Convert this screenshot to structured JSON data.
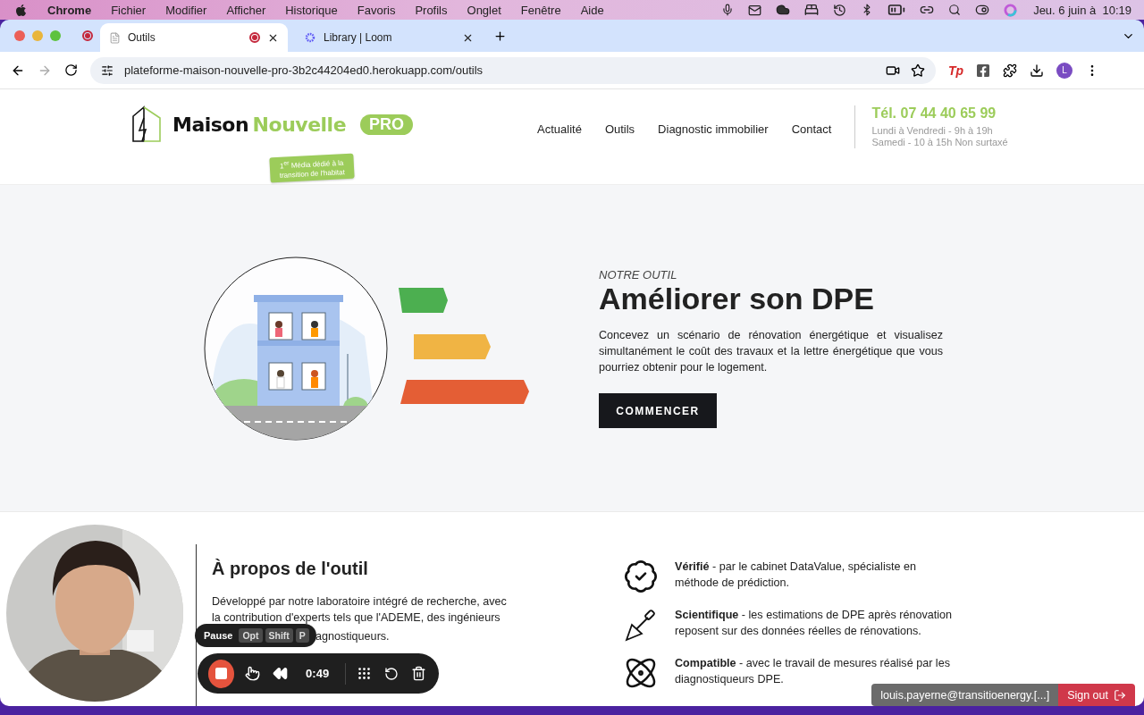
{
  "menubar": {
    "app": "Chrome",
    "menus": [
      "Fichier",
      "Modifier",
      "Afficher",
      "Historique",
      "Favoris",
      "Profils",
      "Onglet",
      "Fenêtre",
      "Aide"
    ],
    "clock": "Jeu. 6 juin à  10:19"
  },
  "tabs": [
    {
      "title": "Outils",
      "selected": true,
      "recording": true
    },
    {
      "title": "Library | Loom",
      "selected": false,
      "recording": false
    }
  ],
  "address": {
    "url": "plateforme-maison-nouvelle-pro-3b2c44204ed0.herokuapp.com/outils"
  },
  "extension_label": "Tp",
  "profile_initial": "L",
  "site": {
    "logo": {
      "word1": "Maison",
      "word2": "Nouvelle",
      "badge": "PRO",
      "tagline": "1$^{er}$ Média dédié à la transition de l'habitat"
    },
    "nav": [
      "Actualité",
      "Outils",
      "Diagnostic immobilier",
      "Contact"
    ],
    "phone": "Tél. 07 44 40 65 99",
    "hours": [
      "Lundi à Vendredi - 9h à 19h",
      "Samedi - 10 à 15h Non surtaxé"
    ]
  },
  "hero": {
    "eyebrow": "NOTRE OUTIL",
    "title": "Améliorer son DPE",
    "text": "Concevez un scénario de rénovation énergétique et visualisez simultanément le coût des travaux et la lettre énergétique que vous pourriez obtenir pour le logement.",
    "button": "COMMENCER"
  },
  "about": {
    "title": "À propos de l'outil",
    "text": "Développé par notre laboratoire intégré de recherche, avec la contribution d'experts tels que l'ADEME, des ingénieurs",
    "text_tail": "agnostiqueurs.",
    "features": [
      {
        "kind": "verified",
        "text": "**Vérifié** - par le cabinet DataValue, spécialiste en méthode de prédiction."
      },
      {
        "kind": "trowel",
        "text": "**Scientifique** - les estimations de DPE après rénovation reposent sur des données réelles de rénovations."
      },
      {
        "kind": "atom",
        "text": "**Compatible** - avec le travail de mesures réalisé par les diagnostiqueurs DPE."
      }
    ]
  },
  "recorder": {
    "tooltip": "Pause",
    "keys": [
      "Opt",
      "Shift",
      "P"
    ],
    "timer": "0:49"
  },
  "session": {
    "email": "louis.payerne@transitioenergy.[...]",
    "signout": "Sign out"
  }
}
